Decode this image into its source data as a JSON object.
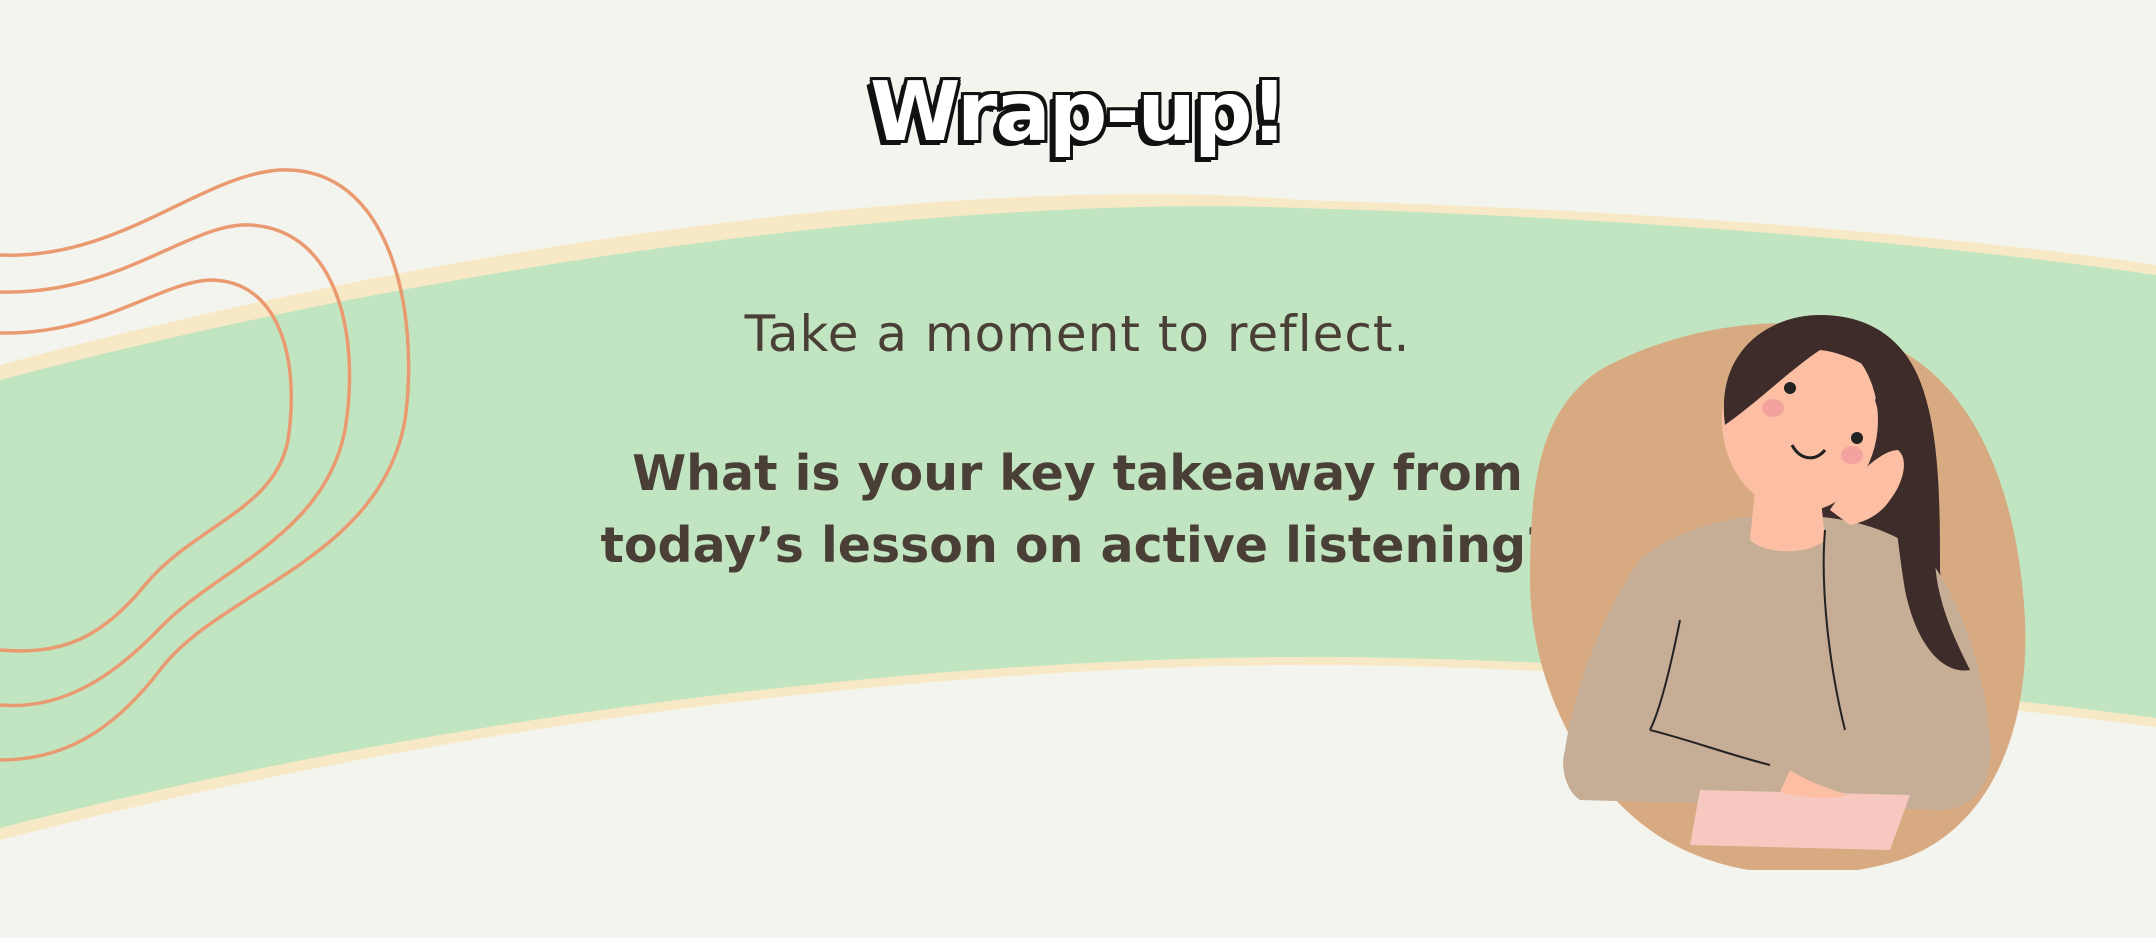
{
  "slide": {
    "title": "Wrap-up!",
    "subtitle": "Take a moment to reflect.",
    "question": "What is your key takeaway from today’s lesson on active listening?"
  },
  "colors": {
    "background": "#f4f4ef",
    "band_green": "#c1e5c1",
    "band_edge": "#f8e9c6",
    "squiggle": "#ea9a70",
    "text": "#4a3f37",
    "blob": "#d8aa82",
    "sweater": "#c6ad96",
    "skin": "#fcbfa3",
    "hair": "#3d2c29"
  },
  "icons": {
    "squiggle": "decorative-squiggle-lines",
    "illustration": "thinking-woman-illustration"
  }
}
